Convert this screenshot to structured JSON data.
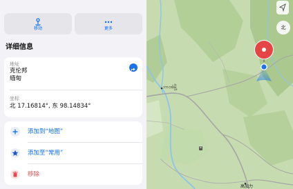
{
  "toolbar": {
    "move_label": "移动",
    "more_label": "更多",
    "move_icon": "pin-move-icon",
    "more_icon": "ellipsis-icon"
  },
  "details": {
    "section_title": "详细信息",
    "address_label": "地址",
    "address_line1": "克伦邦",
    "address_line2": "缅甸",
    "coords_label": "坐标",
    "coords_value": "北 17.16814°, 东 98.14834°"
  },
  "actions": {
    "add_to_map": "添加到“地图”",
    "add_to_favorites": "添加至“常用”",
    "remove": "移除"
  },
  "map": {
    "town_label": "ဘားအံမြို့",
    "town2_label": "高加力",
    "compass_label": "北",
    "road_shield": "8",
    "colors": {
      "land": "#c9dfb4",
      "river": "#8ec4e6",
      "road": "#a7a7a7",
      "pin_red": "#e64545",
      "user_blue": "#1a73e8",
      "accent": "#0a6cf2",
      "destructive": "#e5484d"
    }
  }
}
